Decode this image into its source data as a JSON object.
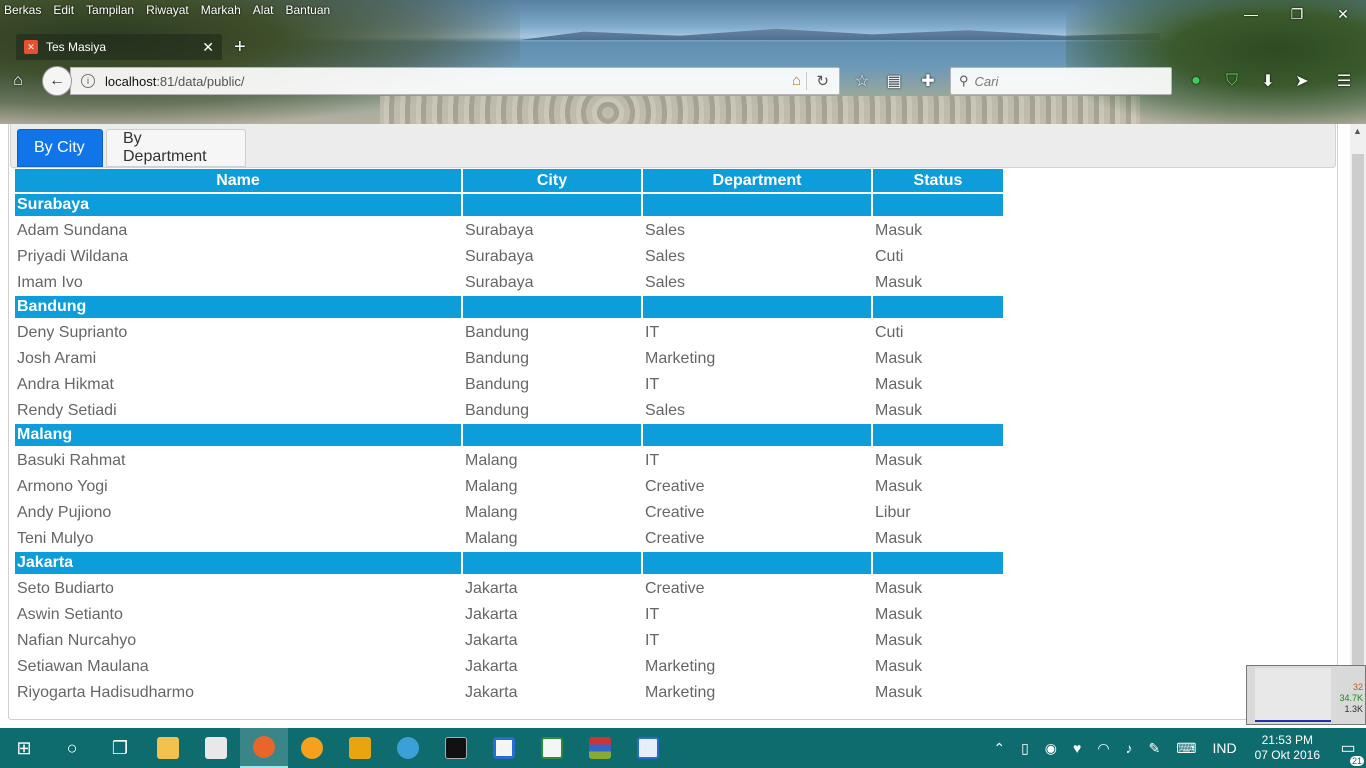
{
  "browser": {
    "menu": [
      "Berkas",
      "Edit",
      "Tampilan",
      "Riwayat",
      "Markah",
      "Alat",
      "Bantuan"
    ],
    "tab_title": "Tes Masiya",
    "url_host": "localhost",
    "url_rest": ":81/data/public/",
    "search_placeholder": "Cari",
    "window_controls": [
      "—",
      "❐",
      "✕"
    ]
  },
  "page": {
    "tabs": [
      {
        "label": "By City",
        "active": true
      },
      {
        "label": "By Department",
        "active": false
      }
    ],
    "columns": [
      "Name",
      "City",
      "Department",
      "Status"
    ],
    "groups": [
      {
        "city": "Surabaya",
        "rows": [
          [
            "Adam Sundana",
            "Surabaya",
            "Sales",
            "Masuk"
          ],
          [
            "Priyadi Wildana",
            "Surabaya",
            "Sales",
            "Cuti"
          ],
          [
            "Imam Ivo",
            "Surabaya",
            "Sales",
            "Masuk"
          ]
        ]
      },
      {
        "city": "Bandung",
        "rows": [
          [
            "Deny Suprianto",
            "Bandung",
            "IT",
            "Cuti"
          ],
          [
            "Josh Arami",
            "Bandung",
            "Marketing",
            "Masuk"
          ],
          [
            "Andra Hikmat",
            "Bandung",
            "IT",
            "Masuk"
          ],
          [
            "Rendy Setiadi",
            "Bandung",
            "Sales",
            "Masuk"
          ]
        ]
      },
      {
        "city": "Malang",
        "rows": [
          [
            "Basuki Rahmat",
            "Malang",
            "IT",
            "Masuk"
          ],
          [
            "Armono Yogi",
            "Malang",
            "Creative",
            "Masuk"
          ],
          [
            "Andy Pujiono",
            "Malang",
            "Creative",
            "Libur"
          ],
          [
            "Teni Mulyo",
            "Malang",
            "Creative",
            "Masuk"
          ]
        ]
      },
      {
        "city": "Jakarta",
        "rows": [
          [
            "Seto Budiarto",
            "Jakarta",
            "Creative",
            "Masuk"
          ],
          [
            "Aswin Setianto",
            "Jakarta",
            "IT",
            "Masuk"
          ],
          [
            "Nafian Nurcahyo",
            "Jakarta",
            "IT",
            "Masuk"
          ],
          [
            "Setiawan Maulana",
            "Jakarta",
            "Marketing",
            "Masuk"
          ],
          [
            "Riyogarta Hadisudharmo",
            "Jakarta",
            "Marketing",
            "Masuk"
          ]
        ]
      }
    ]
  },
  "widget": {
    "values": [
      "32",
      "34.7K",
      "1.3K"
    ]
  },
  "taskbar": {
    "language": "IND",
    "time": "21:53 PM",
    "date": "07 Okt 2016",
    "notification_count": "21"
  },
  "colors": {
    "header_blue": "#0d9ddb",
    "active_tab_blue": "#1174e8",
    "taskbar_teal": "#0e6b6e"
  }
}
